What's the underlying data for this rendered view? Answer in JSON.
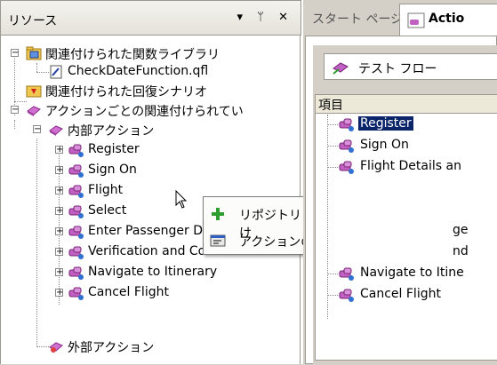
{
  "resources_panel": {
    "title": "リソース",
    "pin_glyph": "▾",
    "pushpin_glyph": "ᛖ",
    "close_glyph": "✕",
    "tree": [
      {
        "label": "関連付けられた関数ライブラリ",
        "icon": "function-library-icon",
        "expanded": true
      },
      {
        "label": "CheckDateFunction.qfl",
        "icon": "qfl-file-icon"
      },
      {
        "label": "関連付けられた回復シナリオ",
        "icon": "recovery-scenario-icon"
      },
      {
        "label": "アクションごとの関連付けられてい",
        "icon": "action-folder-icon",
        "expanded": true
      },
      {
        "label": "内部アクション",
        "icon": "action-folder-icon",
        "expanded": true
      },
      {
        "label": "Register",
        "icon": "action-icon"
      },
      {
        "label": "Sign On",
        "icon": "action-icon"
      },
      {
        "label": "Flight",
        "icon": "action-icon"
      },
      {
        "label": "Select",
        "icon": "action-icon"
      },
      {
        "label": "Enter Passenger Detai",
        "icon": "action-icon"
      },
      {
        "label": "Verification and Confir",
        "icon": "action-icon"
      },
      {
        "label": "Navigate to Itinerary",
        "icon": "action-icon"
      },
      {
        "label": "Cancel Flight",
        "icon": "action-icon"
      },
      {
        "label": "外部アクション",
        "icon": "external-action-icon"
      }
    ]
  },
  "context_menu": {
    "items": [
      {
        "label": "リポジトリとアクションの関連付け",
        "icon": "add-plus-icon"
      },
      {
        "label": "アクションのプロパティ",
        "icon": "properties-icon"
      }
    ]
  },
  "document_tabs": {
    "start_tab": "スタート ページ",
    "active_tab": "Actio"
  },
  "flow_panel": {
    "flow_selector": "テスト フロー",
    "column_header": "項目",
    "items": [
      {
        "label": "Register",
        "selected": true
      },
      {
        "label": "Sign On"
      },
      {
        "label": "Flight Details an"
      },
      {
        "label": ""
      },
      {
        "label": "ge"
      },
      {
        "label": "nd"
      },
      {
        "label": "Navigate to Itine"
      },
      {
        "label": "Cancel Flight"
      }
    ]
  },
  "colors": {
    "selection": "#0a246a",
    "action_icon": "#c060c0",
    "add_icon": "#2e9e2e"
  }
}
